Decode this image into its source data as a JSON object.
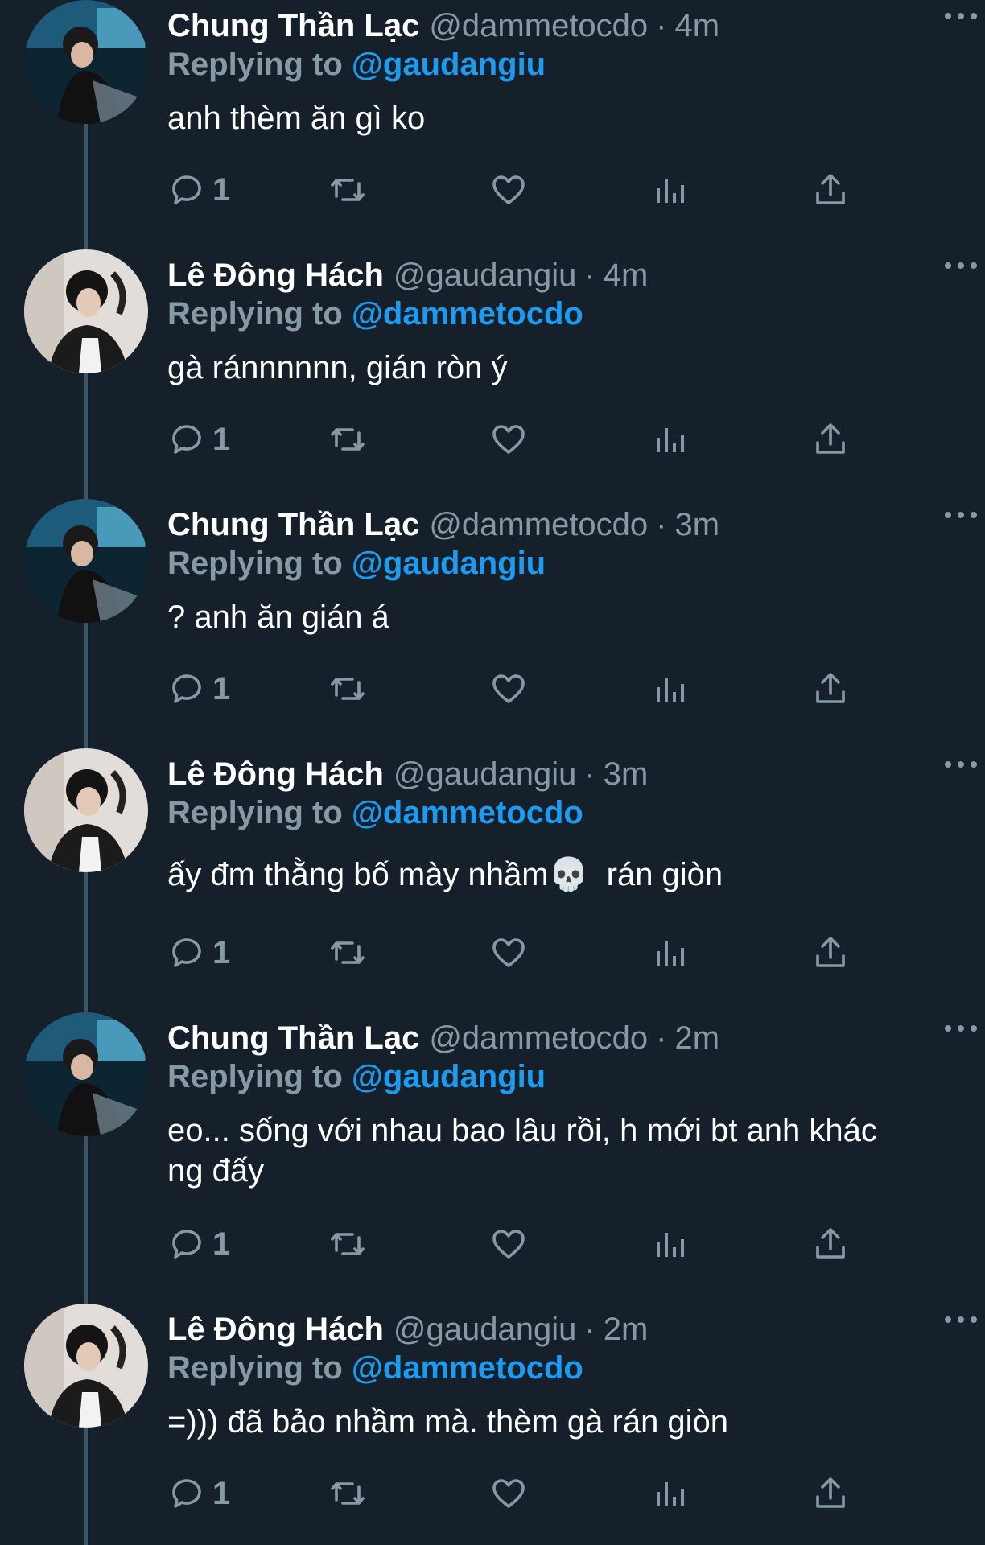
{
  "thread": [
    {
      "display_name": "Chung Thần Lạc",
      "handle": "@dammetocdo",
      "separator": "·",
      "time": "4m",
      "reply_prefix": "Replying to",
      "reply_to": "@gaudangiu",
      "text": "anh thèm ăn gì ko",
      "reply_count": "1",
      "avatar": "avatar-chung"
    },
    {
      "display_name": "Lê Đông Hách",
      "handle": "@gaudangiu",
      "separator": "·",
      "time": "4m",
      "reply_prefix": "Replying to",
      "reply_to": "@dammetocdo",
      "text": "gà ránnnnnn, gián ròn ý",
      "reply_count": "1",
      "avatar": "avatar-le"
    },
    {
      "display_name": "Chung Thần Lạc",
      "handle": "@dammetocdo",
      "separator": "·",
      "time": "3m",
      "reply_prefix": "Replying to",
      "reply_to": "@gaudangiu",
      "text": "? anh ăn gián á",
      "reply_count": "1",
      "avatar": "avatar-chung"
    },
    {
      "display_name": "Lê Đông Hách",
      "handle": "@gaudangiu",
      "separator": "·",
      "time": "3m",
      "reply_prefix": "Replying to",
      "reply_to": "@dammetocdo",
      "text": "ấy đm thằng bố mày nhầm💀  rán giòn",
      "reply_count": "1",
      "avatar": "avatar-le"
    },
    {
      "display_name": "Chung Thần Lạc",
      "handle": "@dammetocdo",
      "separator": "·",
      "time": "2m",
      "reply_prefix": "Replying to",
      "reply_to": "@gaudangiu",
      "text": "eo... sống với nhau bao lâu rồi, h mới bt anh khác ng đấy",
      "reply_count": "1",
      "avatar": "avatar-chung"
    },
    {
      "display_name": "Lê Đông Hách",
      "handle": "@gaudangiu",
      "separator": "·",
      "time": "2m",
      "reply_prefix": "Replying to",
      "reply_to": "@dammetocdo",
      "text": "=))) đã bảo nhầm mà. thèm gà rán giòn",
      "reply_count": "1",
      "avatar": "avatar-le"
    }
  ],
  "colors": {
    "background": "#15202b",
    "secondary_text": "#8899a6",
    "link": "#1d9bf0",
    "thread_line": "#3d5466"
  },
  "icons": [
    "reply-icon",
    "retweet-icon",
    "like-icon",
    "analytics-icon",
    "share-icon",
    "more-icon"
  ]
}
